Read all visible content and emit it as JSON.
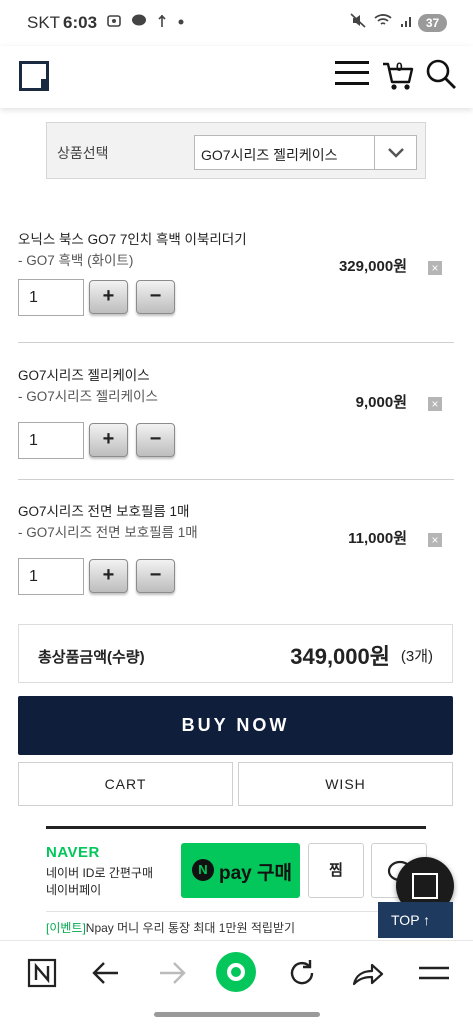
{
  "status_bar": {
    "carrier": "SKT",
    "time": "6:03",
    "battery": "37"
  },
  "header": {
    "cart_count": "0"
  },
  "product_select": {
    "label": "상품선택",
    "selected": "GO7시리즈 젤리케이스"
  },
  "items": [
    {
      "name": "오닉스 북스 GO7 7인치 흑백 이북리더기",
      "option": "- GO7 흑백 (화이트)",
      "quantity": "1",
      "price": "329,000원",
      "remove": "×"
    },
    {
      "name": "GO7시리즈 젤리케이스",
      "option": "- GO7시리즈 젤리케이스",
      "quantity": "1",
      "price": "9,000원",
      "remove": "×"
    },
    {
      "name": "GO7시리즈 전면 보호필름 1매",
      "option": "- GO7시리즈 전면 보호필름 1매",
      "quantity": "1",
      "price": "11,000원",
      "remove": "×"
    }
  ],
  "qty_controls": {
    "plus": "+",
    "minus": "−"
  },
  "total": {
    "label": "총상품금액(수량)",
    "price": "349,000원",
    "count": "(3개)"
  },
  "actions": {
    "buy_now": "BUY NOW",
    "cart": "CART",
    "wish": "WISH"
  },
  "naver_pay": {
    "logo": "NAVER",
    "sub1": "네이버 ID로 간편구매",
    "sub2": "네이버페이",
    "pay_n": "N",
    "pay_label": "pay 구매",
    "zzim": "찜",
    "event_tag": "[이벤트]",
    "event_text": "Npay 머니 우리 통장 최대 1만원 적립받기"
  },
  "floating": {
    "top_label": "TOP ↑"
  },
  "colors": {
    "buy_now_bg": "#0f1e3a",
    "naver_green": "#03c75a",
    "top_btn_bg": "#1e3a5f"
  },
  "icons": [
    "mute-icon",
    "wifi-icon",
    "signal-icon",
    "menu-icon",
    "cart-icon",
    "search-icon",
    "chevron-down-icon",
    "close-icon",
    "n-tab-icon",
    "back-icon",
    "forward-icon",
    "home-circle-icon",
    "reload-icon",
    "share-icon",
    "hamburger-icon"
  ]
}
